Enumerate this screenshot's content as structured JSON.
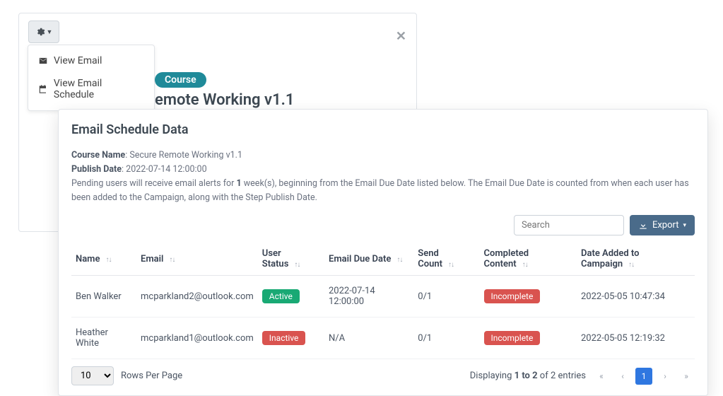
{
  "gear_menu": {
    "item1": "View Email",
    "item2": "View Email Schedule"
  },
  "course_badge": "Course",
  "course_title": "emote Working v1.1",
  "panel": {
    "heading": "Email Schedule Data",
    "course_name_label": "Course Name",
    "course_name": "Secure Remote Working v1.1",
    "publish_date_label": "Publish Date",
    "publish_date": "2022-07-14 12:00:00",
    "pending_pre": "Pending users will receive email alerts for ",
    "pending_weeks": "1",
    "pending_post": " week(s), beginning from the Email Due Date listed below. The Email Due Date is counted from when each user has been added to the Campaign, along with the Step Publish Date."
  },
  "toolbar": {
    "search_placeholder": "Search",
    "export_label": "Export"
  },
  "columns": {
    "name": "Name",
    "email": "Email",
    "user_status": "User Status",
    "email_due": "Email Due Date",
    "send_count": "Send Count",
    "completed": "Completed Content",
    "date_added": "Date Added to Campaign"
  },
  "rows": [
    {
      "name": "Ben Walker",
      "email": "mcparkland2@outlook.com",
      "status": "Active",
      "due": "2022-07-14 12:00:00",
      "send": "0/1",
      "completed": "Incomplete",
      "added": "2022-05-05 10:47:34"
    },
    {
      "name": "Heather White",
      "email": "mcparkland1@outlook.com",
      "status": "Inactive",
      "due": "N/A",
      "send": "0/1",
      "completed": "Incomplete",
      "added": "2022-05-05 12:19:32"
    }
  ],
  "footer": {
    "rows_per_page": "Rows Per Page",
    "rpp_value": "10",
    "displaying_pre": "Displaying ",
    "displaying_range": "1 to 2",
    "displaying_post": " of 2 entries",
    "page": "1"
  }
}
